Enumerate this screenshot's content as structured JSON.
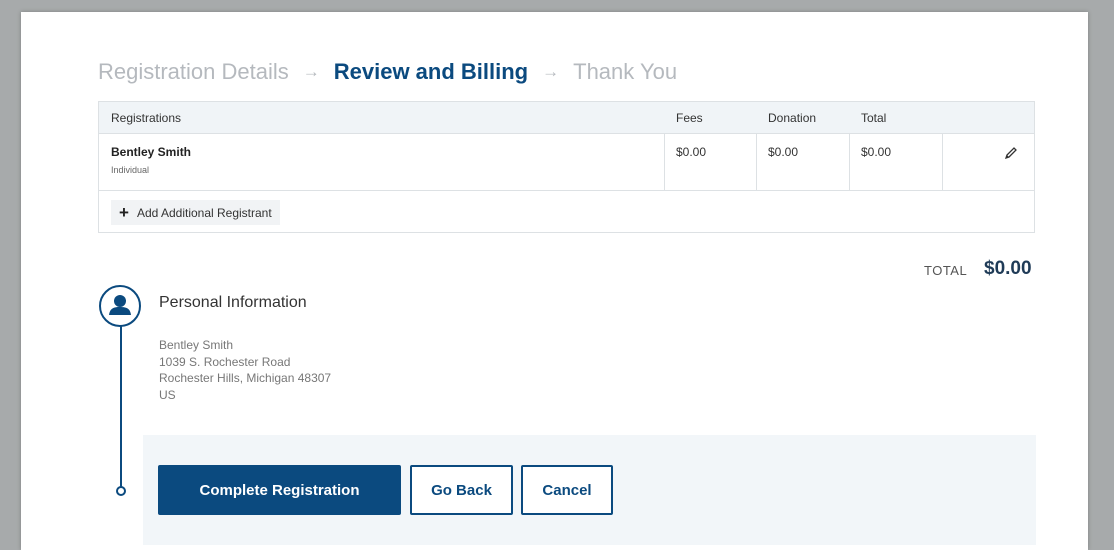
{
  "stepper": {
    "step1": "Registration Details",
    "step2": "Review and Billing",
    "step3": "Thank You",
    "arrow": "→"
  },
  "table": {
    "headers": {
      "registrations": "Registrations",
      "fees": "Fees",
      "donation": "Donation",
      "total": "Total"
    },
    "rows": [
      {
        "name": "Bentley Smith",
        "type": "Individual",
        "fees": "$0.00",
        "donation": "$0.00",
        "total": "$0.00"
      }
    ],
    "add_button": "Add Additional Registrant"
  },
  "summary": {
    "total_label": "TOTAL",
    "total_value": "$0.00"
  },
  "personal": {
    "title": "Personal Information",
    "name": "Bentley Smith",
    "street": "1039 S. Rochester Road",
    "city_line": "Rochester Hills, Michigan 48307",
    "country": "US"
  },
  "actions": {
    "complete": "Complete Registration",
    "back": "Go Back",
    "cancel": "Cancel"
  },
  "colors": {
    "brand": "#0b4a7f",
    "page_background": "#a7aaab",
    "panel": "#f2f6f9",
    "table_header": "#f0f4f7"
  },
  "icons": [
    "arrow-right-icon",
    "pencil-icon",
    "plus-icon",
    "person-icon"
  ]
}
